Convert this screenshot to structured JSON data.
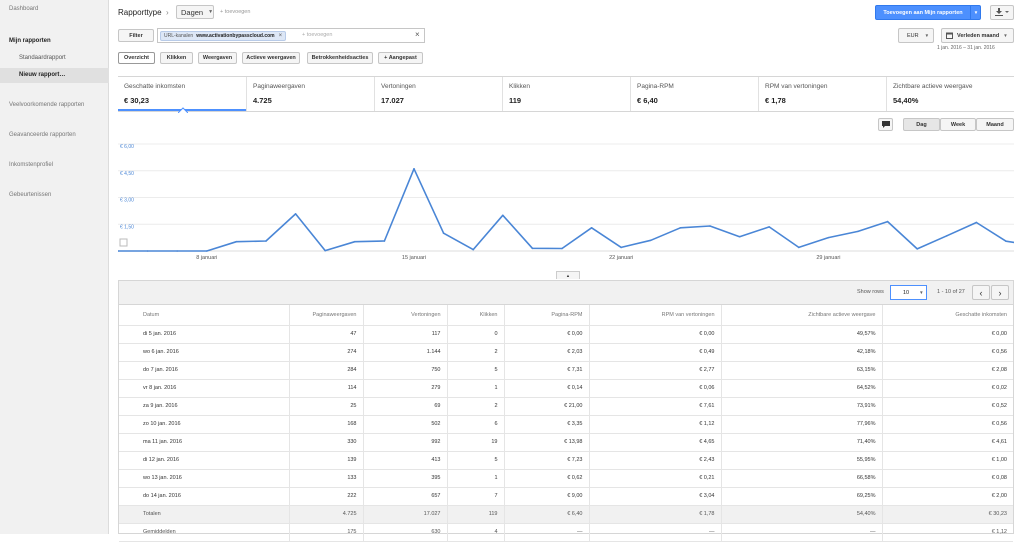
{
  "sidebar": {
    "dashboard": "Dashboard",
    "my_reports": "Mijn rapporten",
    "standard_report": "Standaardrapport",
    "new_report": "Nieuw rapport…",
    "common_reports": "Veelvoorkomende rapporten",
    "advanced_reports": "Geavanceerde rapporten",
    "income_profile": "Inkomstenprofiel",
    "events": "Gebeurtenissen"
  },
  "toolbar": {
    "report_type_label": "Rapporttype",
    "dimension_value": "Dagen",
    "add_label": "+ toevoegen",
    "add_to_reports": "Toevoegen aan Mijn rapporten",
    "currency": "EUR",
    "date_range": "Verleden maand",
    "date_detail": "1 jan. 2016 – 31 jan. 2016"
  },
  "filter": {
    "button": "Filter",
    "chip_prefix": "URL-kanalen",
    "chip_value": "www.activationbypasscloud.com",
    "placeholder": "+ toevoegen"
  },
  "tabs": [
    "Overzicht",
    "Klikken",
    "Weergaven",
    "Actieve weergaven",
    "Betrokkenheidsacties",
    "+ Aangepast"
  ],
  "metrics": [
    {
      "label": "Geschatte inkomsten",
      "value": "€ 30,23"
    },
    {
      "label": "Paginaweergaven",
      "value": "4.725"
    },
    {
      "label": "Vertoningen",
      "value": "17.027"
    },
    {
      "label": "Klikken",
      "value": "119"
    },
    {
      "label": "Pagina-RPM",
      "value": "€ 6,40"
    },
    {
      "label": "RPM van vertoningen",
      "value": "€ 1,78"
    },
    {
      "label": "Zichtbare actieve weergave",
      "value": "54,40%"
    }
  ],
  "granularity": [
    "Dag",
    "Week",
    "Maand"
  ],
  "chart_data": {
    "type": "line",
    "series": [
      {
        "name": "",
        "values": [
          0.0,
          0.0,
          0.0,
          0.0,
          0.52,
          0.56,
          2.08,
          0.02,
          0.52,
          0.56,
          4.61,
          1.0,
          0.08,
          2.0,
          0.15,
          0.14,
          1.3,
          0.2,
          0.6,
          1.3,
          1.4,
          0.8,
          1.35,
          0.2,
          0.75,
          1.1,
          1.65,
          0.12,
          0.85,
          1.6,
          0.55,
          0.28
        ]
      }
    ],
    "x_ticks": [
      "8 januari",
      "15 januari",
      "22 januari",
      "29 januari"
    ],
    "y_ticks": [
      "€ 6,00",
      "€ 4,50",
      "€ 3,00",
      "€ 1,50"
    ],
    "ylim": [
      0,
      6
    ],
    "grid": true,
    "color": "#4a86d6"
  },
  "table": {
    "show_rows_label": "Show rows",
    "rows_value": "10",
    "pagination": "1 - 10 of 27",
    "headers": [
      "Datum",
      "Paginaweergaven",
      "Vertoningen",
      "Klikken",
      "Pagina-RPM",
      "RPM van vertoningen",
      "Zichtbare actieve weergave",
      "Geschatte inkomsten"
    ],
    "rows": [
      [
        "di 5 jan. 2016",
        "47",
        "117",
        "0",
        "€ 0,00",
        "€ 0,00",
        "49,57%",
        "€ 0,00"
      ],
      [
        "wo 6 jan. 2016",
        "274",
        "1.144",
        "2",
        "€ 2,03",
        "€ 0,49",
        "42,18%",
        "€ 0,56"
      ],
      [
        "do 7 jan. 2016",
        "284",
        "750",
        "5",
        "€ 7,31",
        "€ 2,77",
        "63,15%",
        "€ 2,08"
      ],
      [
        "vr 8 jan. 2016",
        "114",
        "279",
        "1",
        "€ 0,14",
        "€ 0,06",
        "64,52%",
        "€ 0,02"
      ],
      [
        "za 9 jan. 2016",
        "25",
        "69",
        "2",
        "€ 21,00",
        "€ 7,61",
        "73,91%",
        "€ 0,52"
      ],
      [
        "zo 10 jan. 2016",
        "168",
        "502",
        "6",
        "€ 3,35",
        "€ 1,12",
        "77,96%",
        "€ 0,56"
      ],
      [
        "ma 11 jan. 2016",
        "330",
        "992",
        "19",
        "€ 13,98",
        "€ 4,65",
        "71,40%",
        "€ 4,61"
      ],
      [
        "di 12 jan. 2016",
        "139",
        "413",
        "5",
        "€ 7,23",
        "€ 2,43",
        "55,95%",
        "€ 1,00"
      ],
      [
        "wo 13 jan. 2016",
        "133",
        "395",
        "1",
        "€ 0,62",
        "€ 0,21",
        "66,58%",
        "€ 0,08"
      ],
      [
        "do 14 jan. 2016",
        "222",
        "657",
        "7",
        "€ 9,00",
        "€ 3,04",
        "69,25%",
        "€ 2,00"
      ]
    ],
    "totals": [
      "Totalen",
      "4.725",
      "17.027",
      "119",
      "€ 6,40",
      "€ 1,78",
      "54,40%",
      "€ 30,23"
    ],
    "averages": [
      "Gemiddelden",
      "175",
      "630",
      "4",
      "—",
      "—",
      "—",
      "€ 1,12"
    ]
  }
}
